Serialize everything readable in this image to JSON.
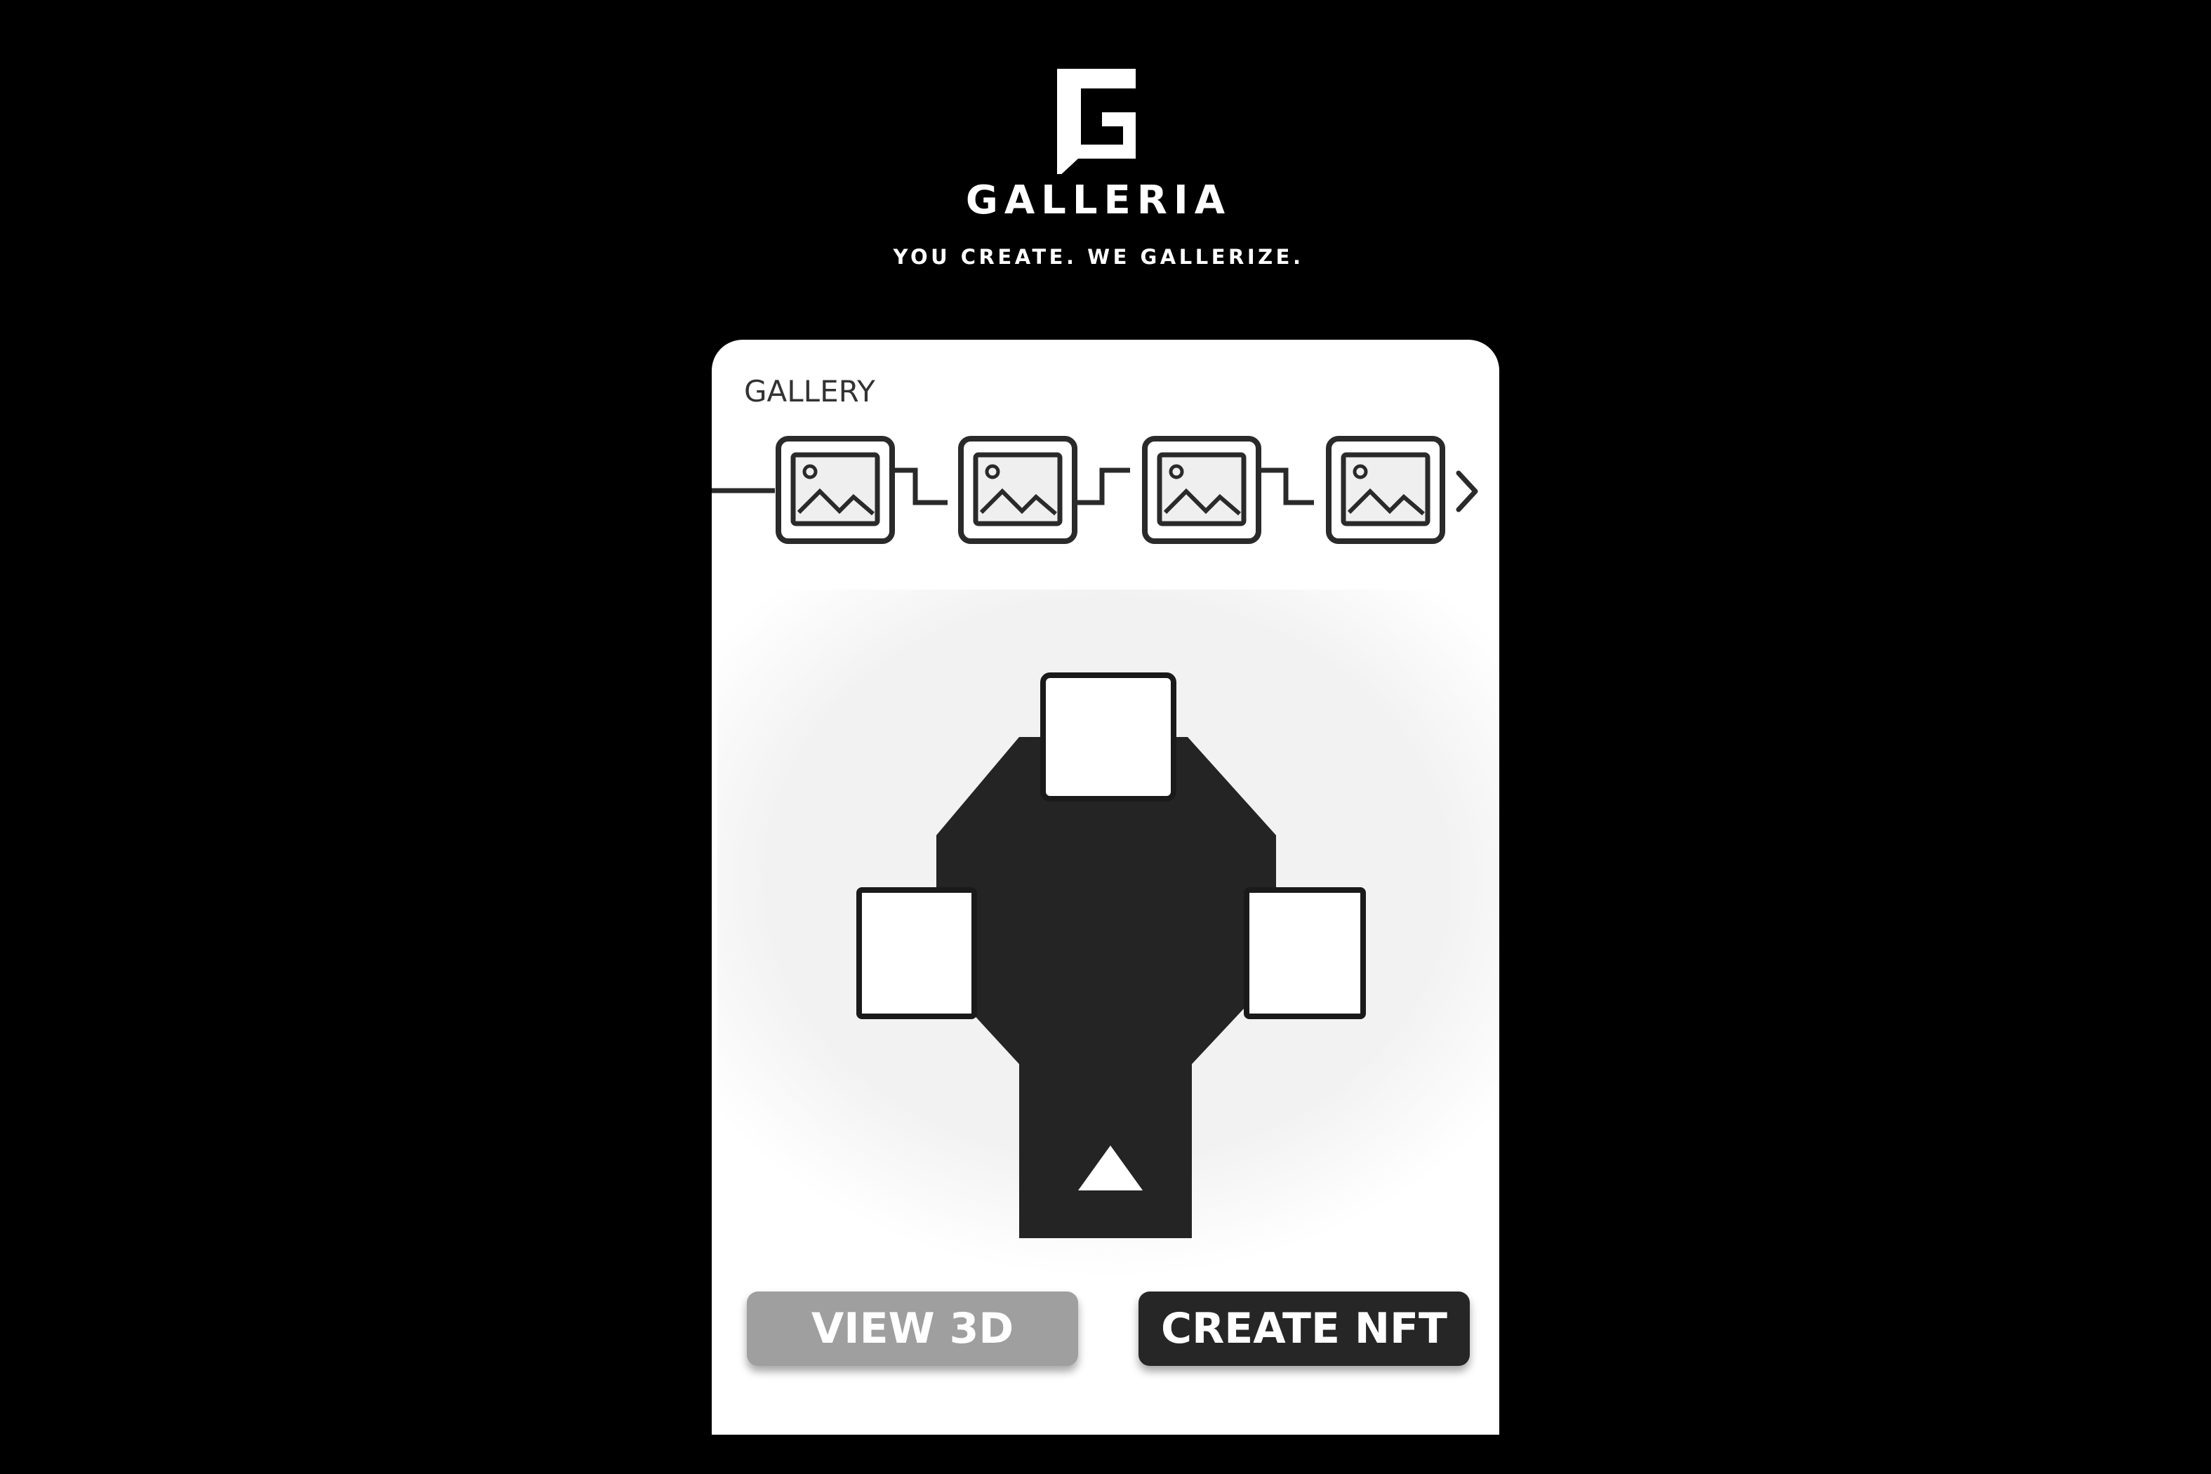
{
  "brand": {
    "logo_icon": "galleria-g-logo-icon",
    "name": "GALLERIA",
    "tagline": "YOU CREATE. WE GALLERIZE."
  },
  "gallery": {
    "label": "GALLERY",
    "thumbnails": [
      {
        "icon": "image-icon"
      },
      {
        "icon": "image-icon"
      },
      {
        "icon": "image-icon"
      },
      {
        "icon": "image-icon"
      }
    ],
    "next_icon": "chevron-right-icon"
  },
  "floor_plan": {
    "room_color": "#242424",
    "slots": [
      "top",
      "left",
      "right"
    ],
    "entrance_icon": "triangle-up-icon"
  },
  "actions": {
    "view_3d_label": "VIEW 3D",
    "create_nft_label": "CREATE NFT"
  },
  "colors": {
    "background": "#000000",
    "card": "#ffffff",
    "view_button": "#9f9f9f",
    "create_button": "#262626"
  }
}
